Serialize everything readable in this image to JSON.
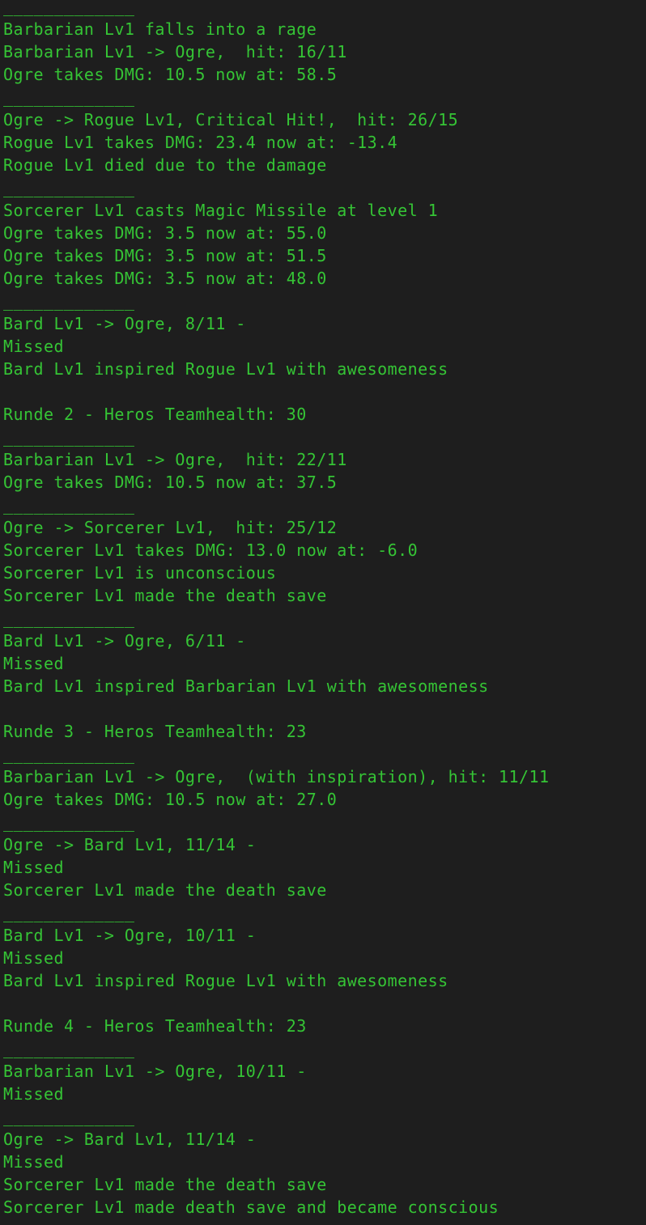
{
  "terminal": {
    "text_color": "#35c435",
    "background_color": "#1e1e1e",
    "lines": [
      "_____________",
      "Barbarian Lv1 falls into a rage",
      "Barbarian Lv1 -> Ogre,  hit: 16/11",
      "Ogre takes DMG: 10.5 now at: 58.5",
      "_____________",
      "Ogre -> Rogue Lv1, Critical Hit!,  hit: 26/15",
      "Rogue Lv1 takes DMG: 23.4 now at: -13.4",
      "Rogue Lv1 died due to the damage",
      "_____________",
      "Sorcerer Lv1 casts Magic Missile at level 1",
      "Ogre takes DMG: 3.5 now at: 55.0",
      "Ogre takes DMG: 3.5 now at: 51.5",
      "Ogre takes DMG: 3.5 now at: 48.0",
      "_____________",
      "Bard Lv1 -> Ogre, 8/11 -",
      "Missed",
      "Bard Lv1 inspired Rogue Lv1 with awesomeness",
      "",
      "Runde 2 - Heros Teamhealth: 30",
      "_____________",
      "Barbarian Lv1 -> Ogre,  hit: 22/11",
      "Ogre takes DMG: 10.5 now at: 37.5",
      "_____________",
      "Ogre -> Sorcerer Lv1,  hit: 25/12",
      "Sorcerer Lv1 takes DMG: 13.0 now at: -6.0",
      "Sorcerer Lv1 is unconscious",
      "Sorcerer Lv1 made the death save",
      "_____________",
      "Bard Lv1 -> Ogre, 6/11 -",
      "Missed",
      "Bard Lv1 inspired Barbarian Lv1 with awesomeness",
      "",
      "Runde 3 - Heros Teamhealth: 23",
      "_____________",
      "Barbarian Lv1 -> Ogre,  (with inspiration), hit: 11/11",
      "Ogre takes DMG: 10.5 now at: 27.0",
      "_____________",
      "Ogre -> Bard Lv1, 11/14 -",
      "Missed",
      "Sorcerer Lv1 made the death save",
      "_____________",
      "Bard Lv1 -> Ogre, 10/11 -",
      "Missed",
      "Bard Lv1 inspired Rogue Lv1 with awesomeness",
      "",
      "Runde 4 - Heros Teamhealth: 23",
      "_____________",
      "Barbarian Lv1 -> Ogre, 10/11 -",
      "Missed",
      "_____________",
      "Ogre -> Bard Lv1, 11/14 -",
      "Missed",
      "Sorcerer Lv1 made the death save",
      "Sorcerer Lv1 made death save and became conscious"
    ]
  }
}
